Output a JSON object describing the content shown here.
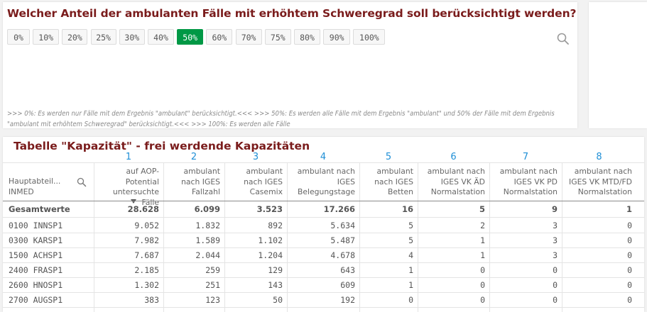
{
  "filter": {
    "title": "Welcher Anteil der ambulanten Fälle mit erhöhtem Schweregrad soll berücksichtigt werden?",
    "options": [
      "0%",
      "10%",
      "20%",
      "25%",
      "30%",
      "40%",
      "50%",
      "60%",
      "70%",
      "75%",
      "80%",
      "90%",
      "100%"
    ],
    "selected": "50%",
    "footnote": ">>> 0%: Es werden nur Fälle mit dem Ergebnis \"ambulant\" berücksichtigt.<<< >>> 50%: Es werden alle Fälle mit dem Ergebnis \"ambulant\" und 50% der Fälle mit dem Ergebnis \"ambulant mit erhöhtem Schweregrad\" berücksichtigt.<<< >>> 100%: Es werden alle Fälle",
    "search_icon": "search-icon"
  },
  "table": {
    "title": "Tabelle \"Kapazität\" - frei werdende Kapazitäten",
    "column_numbers": [
      "1",
      "2",
      "3",
      "4",
      "5",
      "6",
      "7",
      "8"
    ],
    "headers": [
      "Hauptabteil...\nINMED",
      "auf AOP-\nPotential\nuntersuchte Fälle",
      "ambulant\nnach IGES\nFallzahl",
      "ambulant\nnach IGES\nCasemix",
      "ambulant nach\nIGES\nBelegungstage",
      "ambulant\nnach IGES\nBetten",
      "ambulant nach\nIGES VK ÄD\nNormalstation",
      "ambulant nach\nIGES VK PD\nNormalstation",
      "ambulant nach\nIGES VK MTD/FD\nNormalstation"
    ],
    "totals": [
      "Gesamtwerte",
      "28.628",
      "6.099",
      "3.523",
      "17.266",
      "16",
      "5",
      "9",
      "1"
    ],
    "rows": [
      [
        "0100 INNSP1",
        "9.052",
        "1.832",
        "892",
        "5.634",
        "5",
        "2",
        "3",
        "0"
      ],
      [
        "0300 KARSP1",
        "7.982",
        "1.589",
        "1.102",
        "5.487",
        "5",
        "1",
        "3",
        "0"
      ],
      [
        "1500 ACHSP1",
        "7.687",
        "2.044",
        "1.204",
        "4.678",
        "4",
        "1",
        "3",
        "0"
      ],
      [
        "2400 FRASP1",
        "2.185",
        "259",
        "129",
        "643",
        "1",
        "0",
        "0",
        "0"
      ],
      [
        "2600 HNOSP1",
        "1.302",
        "251",
        "143",
        "609",
        "1",
        "0",
        "0",
        "0"
      ],
      [
        "2700 AUGSP1",
        "383",
        "123",
        "50",
        "192",
        "0",
        "0",
        "0",
        "0"
      ]
    ],
    "sort_indicator": "sort-descending-icon",
    "accent_color": "#1f8fd6",
    "title_color": "#7a1c1c",
    "selected_color": "#009845"
  }
}
